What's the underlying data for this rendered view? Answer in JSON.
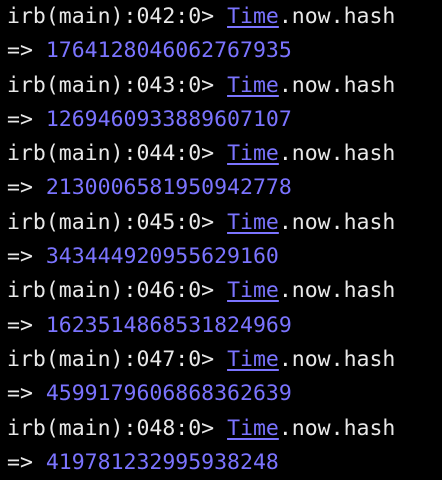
{
  "colors": {
    "background": "#000000",
    "text": "#e8e8e8",
    "accent": "#7b74ff"
  },
  "session": [
    {
      "prompt": "irb(main):042:0> ",
      "const": "Time",
      "rest": ".now.hash",
      "arrow": "=> ",
      "result": "1764128046062767935"
    },
    {
      "prompt": "irb(main):043:0> ",
      "const": "Time",
      "rest": ".now.hash",
      "arrow": "=> ",
      "result": "1269460933889607107"
    },
    {
      "prompt": "irb(main):044:0> ",
      "const": "Time",
      "rest": ".now.hash",
      "arrow": "=> ",
      "result": "2130006581950942778"
    },
    {
      "prompt": "irb(main):045:0> ",
      "const": "Time",
      "rest": ".now.hash",
      "arrow": "=> ",
      "result": "343444920955629160"
    },
    {
      "prompt": "irb(main):046:0> ",
      "const": "Time",
      "rest": ".now.hash",
      "arrow": "=> ",
      "result": "1623514868531824969"
    },
    {
      "prompt": "irb(main):047:0> ",
      "const": "Time",
      "rest": ".now.hash",
      "arrow": "=> ",
      "result": "4599179606868362639"
    },
    {
      "prompt": "irb(main):048:0> ",
      "const": "Time",
      "rest": ".now.hash",
      "arrow": "=> ",
      "result": "419781232995938248"
    }
  ]
}
